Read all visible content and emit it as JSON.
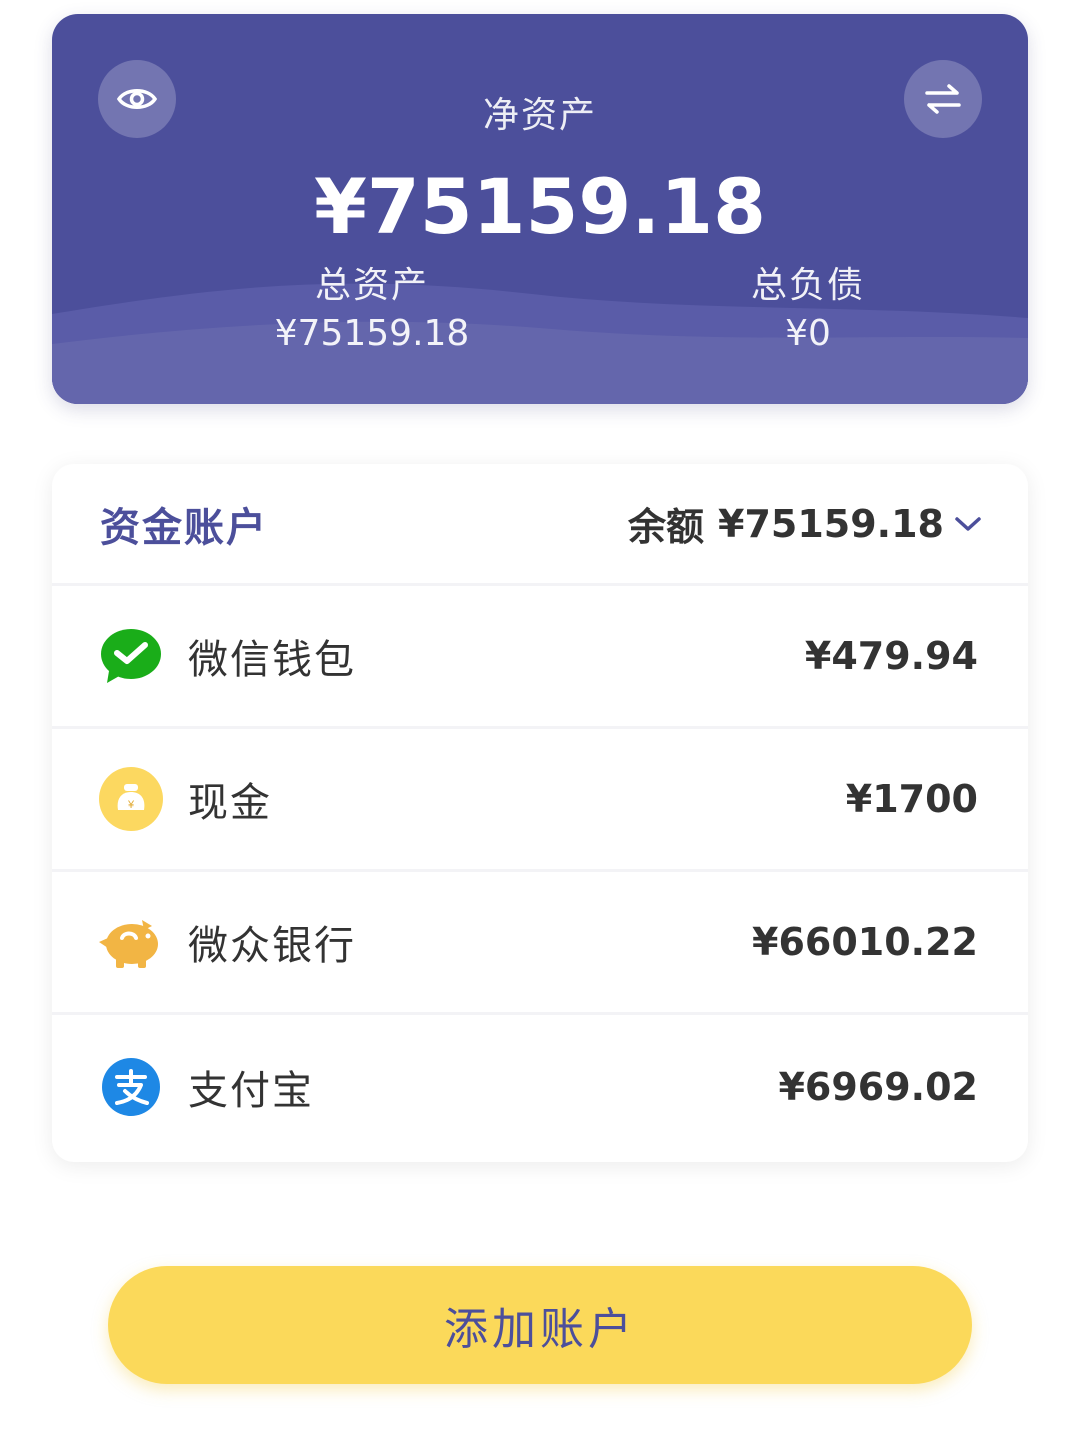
{
  "summary": {
    "net_label": "净资产",
    "net_value": "¥75159.18",
    "assets_label": "总资产",
    "assets_value": "¥75159.18",
    "liabilities_label": "总负债",
    "liabilities_value": "¥0",
    "left_icon": "eye-icon",
    "right_icon": "swap-arrows-icon"
  },
  "accounts": {
    "title": "资金账户",
    "balance_label": "余额",
    "balance_value": "¥75159.18",
    "toggle_icon": "chevron-down-icon",
    "items": [
      {
        "name": "微信钱包",
        "amount": "¥479.94",
        "icon": "wechat-icon"
      },
      {
        "name": "现金",
        "amount": "¥1700",
        "icon": "cash-bag-icon"
      },
      {
        "name": "微众银行",
        "amount": "¥66010.22",
        "icon": "piggy-bank-icon"
      },
      {
        "name": "支付宝",
        "amount": "¥6969.02",
        "icon": "alipay-icon"
      }
    ]
  },
  "add_button_label": "添加账户",
  "colors": {
    "primary": "#4c4f9b",
    "accent_yellow": "#fbd95a",
    "wechat_green": "#1aad19",
    "cash_yellow": "#fcd860",
    "piggy_orange": "#f2b544",
    "alipay_blue": "#1e88e5"
  }
}
